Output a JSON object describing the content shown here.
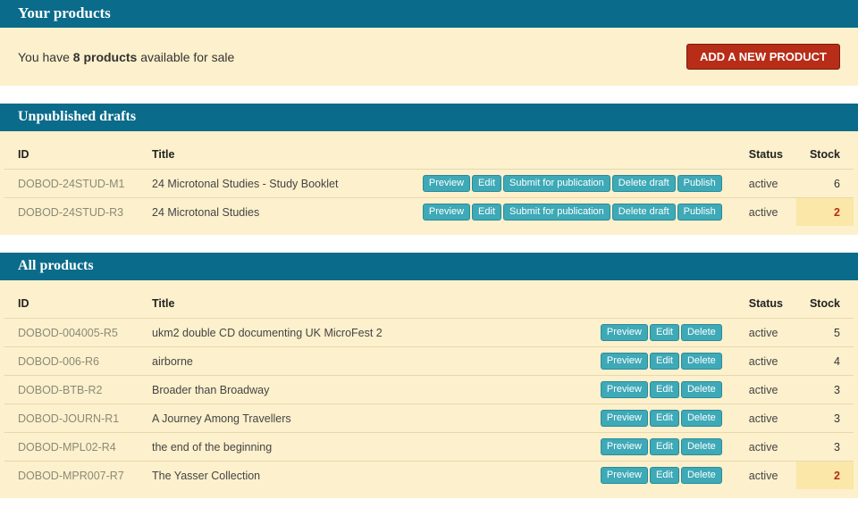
{
  "header": {
    "title": "Your products"
  },
  "counter": {
    "prefix": "You have ",
    "count": "8 products",
    "suffix": " available for sale",
    "add_button": "ADD A NEW PRODUCT"
  },
  "columns": {
    "id": "ID",
    "title": "Title",
    "status": "Status",
    "stock": "Stock"
  },
  "buttons": {
    "preview": "Preview",
    "edit": "Edit",
    "submit": "Submit for publication",
    "delete_draft": "Delete draft",
    "publish": "Publish",
    "delete": "Delete"
  },
  "drafts": {
    "heading": "Unpublished drafts",
    "rows": [
      {
        "id": "DOBOD-24STUD-M1",
        "title": "24 Microtonal Studies - Study Booklet",
        "status": "active",
        "stock": "6",
        "low": false
      },
      {
        "id": "DOBOD-24STUD-R3",
        "title": "24 Microtonal Studies",
        "status": "active",
        "stock": "2",
        "low": true
      }
    ]
  },
  "all": {
    "heading": "All products",
    "rows": [
      {
        "id": "DOBOD-004005-R5",
        "title": "ukm2 double CD documenting UK MicroFest 2",
        "status": "active",
        "stock": "5",
        "low": false
      },
      {
        "id": "DOBOD-006-R6",
        "title": "airborne",
        "status": "active",
        "stock": "4",
        "low": false
      },
      {
        "id": "DOBOD-BTB-R2",
        "title": "Broader than Broadway",
        "status": "active",
        "stock": "3",
        "low": false
      },
      {
        "id": "DOBOD-JOURN-R1",
        "title": "A Journey Among Travellers",
        "status": "active",
        "stock": "3",
        "low": false
      },
      {
        "id": "DOBOD-MPL02-R4",
        "title": "the end of the beginning",
        "status": "active",
        "stock": "3",
        "low": false
      },
      {
        "id": "DOBOD-MPR007-R7",
        "title": "The Yasser Collection",
        "status": "active",
        "stock": "2",
        "low": true
      }
    ]
  }
}
